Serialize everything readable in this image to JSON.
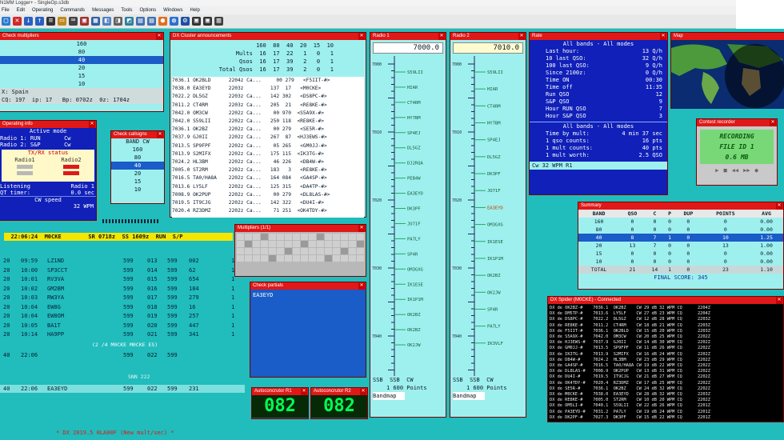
{
  "app": {
    "title": "N1MM Logger+  -  SingleOp.s3db",
    "menu": [
      "File",
      "Edit",
      "Operating",
      "Commands",
      "Messages",
      "Tools",
      "Options",
      "Windows",
      "Help"
    ]
  },
  "check_multipliers": {
    "title": "Check multipliers",
    "rows": [
      "160",
      "80",
      "40",
      "20",
      "15",
      "10"
    ],
    "selected_index": 2,
    "footer1": "X: Spain",
    "footer2": "CQ: 197  ip: 17   Bp: 0702z  0z: 1704z"
  },
  "dx_cluster": {
    "title": "DX Cluster announcements",
    "header": {
      "bands": "160  80  40  20  15  10",
      "mults_label": "Mults",
      "mults": "16  17  22   1   0   1",
      "qsos_label": "Qsos",
      "qsos": "16  17  39   2   0   1",
      "total_label": "Total Qsos",
      "total": "16  17  39   2   0   1"
    },
    "spots": [
      "7036.1 OK2BLD      2204z Ca...     00 279   <F5IIT-#>",
      "7038.0 EA3EYD      2203z         137  17   <M0CKE>",
      "7022.2 DL5GZ       2203z Ca...   142 302   <DS8PC-#>",
      "7011.2 CT4RM       2203z Ca...   205  21   <RE8KE-#>",
      "7042.0 OM3CW       2202z Ca...    00 970  <S5A9X-#>",
      "7042.0 S59LII      2202z Ca...   250 118  <RE8KE-#>",
      "7036.1 OK2BZ       2202z Ca...    00 279   <SE5R-#>",
      "7037.9 GJ0II       2202z Ca...   267  87  <HJ3EWS-#>",
      "7013.5 SP9FPF      2202z Ca...    05 265   <GM0JJ-#>",
      "7013.9 S2MIFX      2202z Ca...   175 115  <IK3TG-#>",
      "7024.2 HL3BM       2202z Ca...    46 226   <DB4W-#>",
      "7005.0 ST2RM       2202z Ca...   183   3   <RE8KE-#>",
      "7016.5 TA0/HA8A    2202z Ca...   164 084   <GA4SP-#>",
      "7013.6 LY5LF       2202z Ca...   125 315   <DA4TP-#>",
      "7008.9 OK2PUP      2202z Ca...    00 279   <DL8LAS-#>",
      "7019.5 IT9CJG      2202z Ca...   142 322   <DU4I-#>",
      "7020.4 RZ3DMZ      2202z Ca...    71 251  <OK4TDY-#>"
    ]
  },
  "radio1": {
    "title": "Radio 1",
    "freq": "7000.0",
    "ticks": [
      "7000",
      "7010",
      "7020",
      "7030",
      "7040"
    ],
    "calls": [
      "S59LII",
      "HIAR",
      "CT4RM",
      "HY7BM",
      "SP4EJ",
      "DL5GZ",
      "DJ2RQA",
      "PEB4W",
      "EA3EYD",
      "DK3PF",
      "JO71F",
      "PA7LY",
      "SP4R",
      "OM3GXG",
      "IK1ESE",
      "IK1P1M",
      "OK2BZ",
      "OK2BZ",
      "OK2JW"
    ],
    "mode": "SSB  SSB  CW",
    "points": "1 600 Points",
    "band_map": "Bandmap"
  },
  "radio2": {
    "title": "Radio 2",
    "freq": "7010.0",
    "ticks": [
      "7000",
      "7010",
      "7020",
      "7030",
      "7040"
    ],
    "highlight": "EA3EYD",
    "calls": [
      "S59LII",
      "HIAR",
      "CT4RM",
      "HY7BM",
      "SP4EJ",
      "DL5GZ",
      "DK3PF",
      "JO71F",
      "EA3EYD",
      "OM3GXG",
      "IK1ESE",
      "IK1P1M",
      "OK2BZ",
      "OK2JW",
      "SP4R",
      "PA7LY",
      "IK3VLF"
    ],
    "mode": "SSB  SSB  CW",
    "points": "1 600 Points",
    "band_map": "Bandmap"
  },
  "rate": {
    "title": "Rate",
    "section1": {
      "title": "All bands - All modes",
      "rows": [
        [
          "Last hour:",
          "13 Q/h"
        ],
        [
          "10 last QSO:",
          "32 Q/h"
        ],
        [
          "100 last QSO:",
          "9 Q/h"
        ],
        [
          "Since 2100z:",
          "0 Q/h"
        ],
        [
          "Time ON",
          "00:30"
        ],
        [
          "Time off",
          "11:35"
        ],
        [
          "Run QSO",
          "12"
        ],
        [
          "S&P QSO",
          "9"
        ],
        [
          "Hour RUN QSO",
          "7"
        ],
        [
          "Hour S&P QSO",
          "3"
        ]
      ]
    },
    "section2": {
      "title": "All bands - All modes",
      "rows": [
        [
          "Time by mult:",
          "4 min 37 sec"
        ],
        [
          "1 qso counts:",
          "16 pts"
        ],
        [
          "1 mult counts:",
          "40 pts"
        ],
        [
          "1 mult worth:",
          "2.5 QSO"
        ]
      ]
    },
    "footer": "Cw  32 WPM   R1"
  },
  "map": {
    "title": "Map"
  },
  "contest_recorder": {
    "title": "Contest recorder",
    "line1": "RECORDING",
    "line2": "FILE ID 1",
    "line3": "0.6 MB"
  },
  "summary": {
    "title": "Summary",
    "headers": [
      "BAND",
      "QSO",
      "C",
      "P",
      "DUP",
      "POINTS",
      "AVG"
    ],
    "rows": [
      [
        "160",
        "0",
        "0",
        "0",
        "0",
        "0",
        "0.00"
      ],
      [
        "80",
        "0",
        "0",
        "0",
        "0",
        "0",
        "0.00"
      ],
      [
        "40",
        "8",
        "7",
        "1",
        "0",
        "10",
        "1.25"
      ],
      [
        "20",
        "13",
        "7",
        "0",
        "0",
        "13",
        "1.00"
      ],
      [
        "15",
        "0",
        "0",
        "0",
        "0",
        "0",
        "0.00"
      ],
      [
        "10",
        "0",
        "0",
        "0",
        "0",
        "0",
        "0.00"
      ]
    ],
    "selected_index": 2,
    "total": [
      "TOTAL",
      "21",
      "14",
      "1",
      "0",
      "23",
      "1.10"
    ],
    "final": "FINAL SCORE:  345"
  },
  "operating_info": {
    "title": "Operating info",
    "active": "Active mode",
    "lines": [
      "Radio 1: RUN       Cw",
      "Radio 2: S&P       Cw"
    ],
    "status_title": "TX/RX status",
    "r1": "Radio1",
    "r2": "Radio2",
    "listening": "Listening            Radio 1",
    "elapsed": "QT timer:            0.0 sec",
    "cw_speed": "CW speed",
    "wpm": "32 WPM"
  },
  "check_callsigns": {
    "title": "Check callsigns",
    "header": "BAND  CW",
    "rows": [
      "160",
      "80",
      "40",
      "20",
      "15",
      "10"
    ],
    "selected_index": 2
  },
  "multipliers": {
    "title": "Multipliers (1/1)"
  },
  "check_partials": {
    "title": "Check partials",
    "value": "EA3EYD"
  },
  "status_bar": {
    "time": "22:06:24",
    "call": "M0CKE",
    "sent": "SR 0718z",
    "ss": "SS 1609z",
    "mode": "RUN  S/P"
  },
  "log": {
    "rows": [
      [
        "20",
        "09:59",
        "LZ1ND",
        "599",
        "013",
        "599",
        "002",
        "1"
      ],
      [
        "20",
        "10:00",
        "SP3CCT",
        "599",
        "014",
        "599",
        "62",
        "1"
      ],
      [
        "20",
        "10:01",
        "RV3VA",
        "599",
        "015",
        "599",
        "654",
        "1"
      ],
      [
        "20",
        "10:02",
        "GM2BM",
        "599",
        "016",
        "599",
        "184",
        "1"
      ],
      [
        "20",
        "10:03",
        "RW3YA",
        "599",
        "017",
        "599",
        "279",
        "1"
      ],
      [
        "20",
        "10:04",
        "EW8G",
        "599",
        "018",
        "599",
        "16",
        "1"
      ],
      [
        "20",
        "10:04",
        "EW8OM",
        "599",
        "019",
        "599",
        "257",
        "1"
      ],
      [
        "20",
        "10:05",
        "BA1T",
        "599",
        "020",
        "599",
        "447",
        "1"
      ],
      [
        "20",
        "10:14",
        "HA9PP",
        "599",
        "021",
        "599",
        "341",
        "1"
      ]
    ],
    "note": "(2 /4  M0CKE M0CKE ES)",
    "row40": [
      "40",
      "22:06",
      "",
      "599",
      "022",
      "599",
      ""
    ],
    "snn": "SNN 222",
    "entry": [
      "40",
      "22:06",
      "EA3EYD",
      "599",
      "022",
      "599",
      "231"
    ],
    "warning": "* DX 2019.5 0LA00F (New mult/sec) *"
  },
  "autoconcrutor1": {
    "title": "Autoconcrutor R1",
    "value": "082"
  },
  "autoconcrutor2": {
    "title": "Autoconcrutor R2",
    "value": "082"
  },
  "dx_spider": {
    "title": "DX Spider (M0CKE) - Connected",
    "lines": [
      "DX de OK2BZ-#    7036.1  OK2BZ    CW 29 dB 32 WPM CQ      2204Z",
      "DX de DM5TP-#    7013.6  LY5LF    CW 27 dB 23 WPM CQ      2204Z",
      "DX de DS8PC-#    7022.2  DL5GZ    CW 12 dB 28 WPM CQ      2203Z",
      "DX de RE8KE-#    7011.2  CT4RM    CW 18 dB 21 WPM CQ      2203Z",
      "DX de F5IIT-#    7036.1  OK2BLD   CW 15 dB 20 WPM CQ      2203Z",
      "DX de S5A9X-#    7042.0  OM3CW    CW 20 dB 25 WPM CQ      2202Z",
      "DX de HJ3EWS-#   7037.9  GJ0II    CW 14 dB 30 WPM CQ      2202Z",
      "DX de GM0JJ-#    7013.5  SP9FPF   CW 11 dB 26 WPM CQ      2202Z",
      "DX de IK3TG-#    7013.9  S2MIFX   CW 16 dB 24 WPM CQ      2202Z",
      "DX de DB4W-#     7024.2  HL3BM    CW 23 dB 29 WPM CQ      2202Z",
      "DX de GA4SP-#    7016.5  TA0/HA8A CW 19 dB 22 WPM CQ      2202Z",
      "DX de DL8LAS-#   7008.9  OK2PUP   CW 13 dB 31 WPM CQ      2202Z",
      "DX de DU4I-#     7019.5  IT9CJG   CW 21 dB 27 WPM CQ      2202Z",
      "DX de OK4TDY-#   7020.4  RZ3DMZ   CW 17 dB 25 WPM CQ      2202Z",
      "DX de SE5R-#     7036.1  OK2BZ    CW 24 dB 32 WPM CQ      2202Z",
      "DX de M0CKE-#    7038.0  EA3EYD   CW 28 dB 32 WPM CQ      2203Z",
      "DX de RE8KE-#    7005.0  ST2RM    CW 10 dB 20 WPM CQ      2202Z",
      "DX de OM5LI-#    7040.1  S59LII   CW 22 dB 26 WPM CQ      2201Z",
      "DX de PA3EYD-#   7031.2  PA7LY    CW 19 dB 24 WPM CQ      2201Z",
      "DX de DK2PF-#    7027.3  DK3PF    CW 15 dB 22 WPM CQ      2201Z"
    ]
  }
}
